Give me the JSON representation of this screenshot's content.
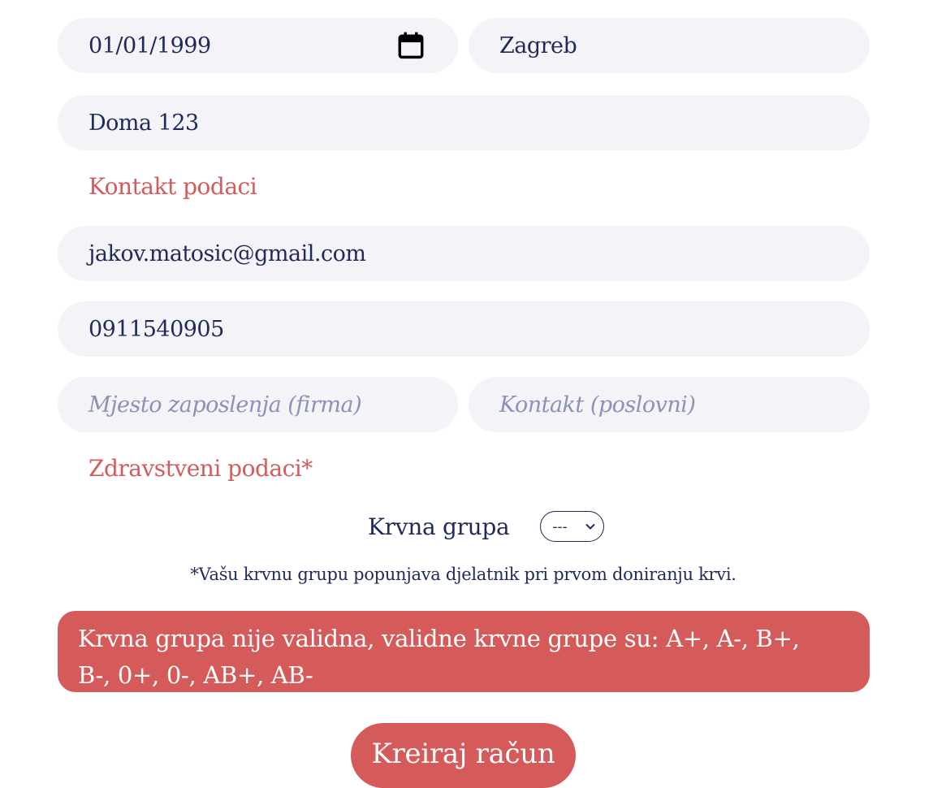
{
  "form": {
    "birth_date": {
      "value": "01/01/1999",
      "icon": "calendar-icon"
    },
    "birth_place": {
      "value": "Zagreb"
    },
    "address": {
      "value": "Doma 123"
    },
    "contact_section_title": "Kontakt podaci",
    "email": {
      "value": "jakov.matosic@gmail.com"
    },
    "phone": {
      "value": "0911540905"
    },
    "employer": {
      "placeholder": "Mjesto zaposlenja (firma)"
    },
    "work_contact": {
      "placeholder": "Kontakt (poslovni)"
    },
    "health_section_title": "Zdravstveni podaci*",
    "blood_group": {
      "label": "Krvna grupa",
      "selected": "---"
    },
    "blood_group_note": "*Vašu krvnu grupu popunjava djelatnik pri prvom doniranju krvi.",
    "error_message": "Krvna grupa nije validna, validne krvne grupe su: A+, A-, B+, B-, 0+, 0-, AB+, AB-",
    "submit_label": "Kreiraj račun"
  },
  "colors": {
    "accent": "#d55b5b",
    "text": "#1d2a5a",
    "field_bg": "#f3f3f8",
    "placeholder": "#8a93b6"
  }
}
